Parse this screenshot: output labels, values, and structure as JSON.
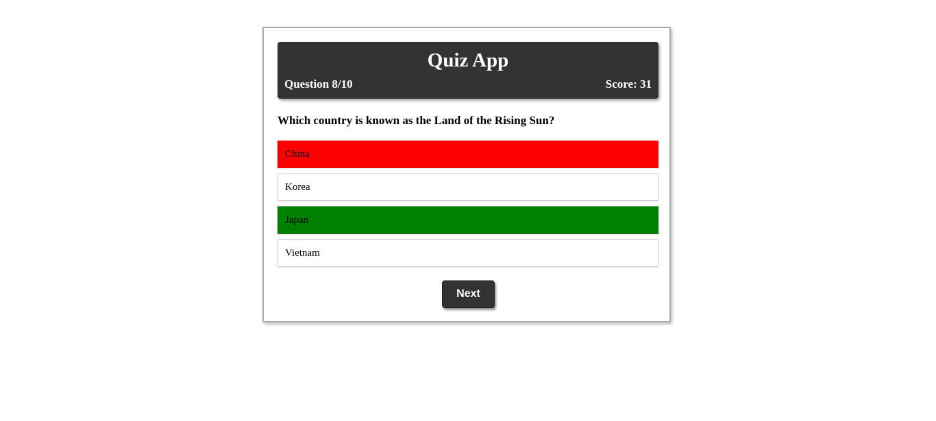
{
  "header": {
    "title": "Quiz App",
    "question_progress": "Question 8/10",
    "score": "Score: 31"
  },
  "question": {
    "text": "Which country is known as the Land of the Rising Sun?"
  },
  "answers": [
    {
      "label": "China",
      "state": "wrong"
    },
    {
      "label": "Korea",
      "state": "neutral"
    },
    {
      "label": "Japan",
      "state": "correct"
    },
    {
      "label": "Vietnam",
      "state": "neutral"
    }
  ],
  "colors": {
    "header_bg": "#333333",
    "wrong": "#ff0000",
    "correct": "#008000"
  },
  "controls": {
    "next_label": "Next"
  }
}
